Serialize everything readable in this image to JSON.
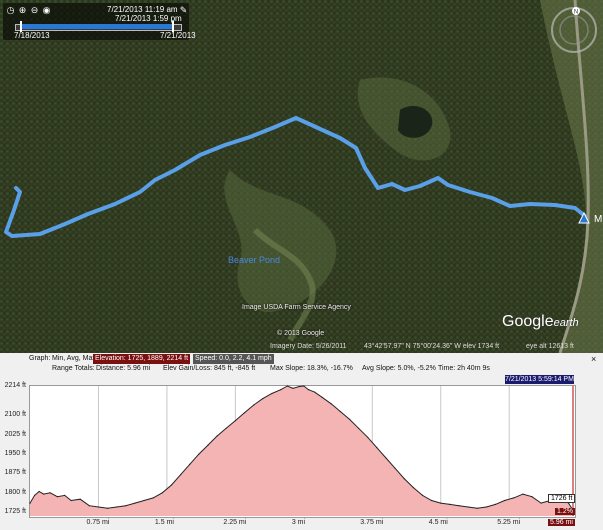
{
  "timeslider": {
    "start_time": "7/21/2013  11:19 am",
    "end_time": "7/21/2013  1:59 pm",
    "range_start": "7/18/2013",
    "range_end": "7/21/2013"
  },
  "map": {
    "place_label": "Beaver Pond",
    "place_marker_label": "M",
    "image_credit": "Image USDA Farm Service Agency",
    "copyright": "© 2013 Google",
    "logo_main": "Google",
    "logo_sub": "earth",
    "track_color": "#5aa0e8"
  },
  "statusbar": {
    "imagery_date": "Imagery Date: 5/26/2011",
    "coords": "43°42'57.97\" N    75°00'24.36\" W  elev  1734 ft",
    "eye_alt": "eye alt  12613 ft"
  },
  "profile": {
    "graph_label": "Graph:",
    "graph_mode": "Min, Avg, Max",
    "elevation_stat": "Elevation: 1725, 1889, 2214 ft",
    "speed_stat": "Speed: 0.0, 2.2, 4.1 mph",
    "range_label": "Range Totals:",
    "distance": "Distance: 5.96 mi",
    "gain_loss": "Elev Gain/Loss: 845 ft, -845 ft",
    "max_slope": "Max Slope: 18.3%, -16.7%",
    "avg_slope": "Avg Slope: 5.0%, -5.2%",
    "time": "Time: 2h 40m 9s",
    "cursor_time": "7/21/2013 5:59:14 PM",
    "end_elev_label": "1726 ft",
    "end_slope_label": "1.2%",
    "end_dist_label": "5.96 mi",
    "close_label": "×"
  },
  "chart_data": {
    "type": "area",
    "xlabel": "",
    "ylabel": "",
    "x_unit": "mi",
    "y_unit": "ft",
    "ylim": [
      1710,
      2214
    ],
    "xlim": [
      0,
      5.96
    ],
    "y_ticks": [
      "2214 ft",
      "2100 ft",
      "2025 ft",
      "1950 ft",
      "1875 ft",
      "1800 ft",
      "1725 ft"
    ],
    "y_tick_values": [
      2214,
      2100,
      2025,
      1950,
      1875,
      1800,
      1725
    ],
    "x_ticks": [
      "0.75 mi",
      "1.5 mi",
      "2.25 mi",
      "3 mi",
      "3.75 mi",
      "4.5 mi",
      "5.25 mi"
    ],
    "x_tick_values": [
      0.75,
      1.5,
      2.25,
      3,
      3.75,
      4.5,
      5.25
    ],
    "grid": true,
    "fill_color": "#f4b4b4",
    "line_color": "#222222",
    "x": [
      0,
      0.05,
      0.1,
      0.15,
      0.22,
      0.3,
      0.38,
      0.45,
      0.55,
      0.65,
      0.75,
      0.85,
      0.95,
      1.05,
      1.15,
      1.25,
      1.35,
      1.45,
      1.55,
      1.65,
      1.75,
      1.85,
      1.95,
      2.05,
      2.15,
      2.25,
      2.35,
      2.45,
      2.55,
      2.65,
      2.75,
      2.82,
      2.88,
      2.95,
      3.0,
      3.05,
      3.12,
      3.2,
      3.3,
      3.4,
      3.5,
      3.6,
      3.7,
      3.8,
      3.9,
      4.0,
      4.1,
      4.2,
      4.3,
      4.4,
      4.5,
      4.6,
      4.7,
      4.8,
      4.9,
      5.0,
      5.1,
      5.2,
      5.3,
      5.4,
      5.5,
      5.6,
      5.7,
      5.8,
      5.9,
      5.96
    ],
    "y": [
      1760,
      1790,
      1805,
      1795,
      1800,
      1785,
      1790,
      1770,
      1775,
      1750,
      1745,
      1740,
      1745,
      1750,
      1760,
      1770,
      1780,
      1800,
      1830,
      1870,
      1910,
      1950,
      1985,
      2020,
      2050,
      2080,
      2110,
      2140,
      2165,
      2185,
      2200,
      2214,
      2205,
      2212,
      2214,
      2200,
      2190,
      2170,
      2145,
      2115,
      2085,
      2050,
      2015,
      1975,
      1935,
      1895,
      1855,
      1820,
      1790,
      1770,
      1760,
      1755,
      1750,
      1745,
      1740,
      1745,
      1755,
      1770,
      1780,
      1795,
      1785,
      1760,
      1770,
      1790,
      1760,
      1726
    ]
  }
}
